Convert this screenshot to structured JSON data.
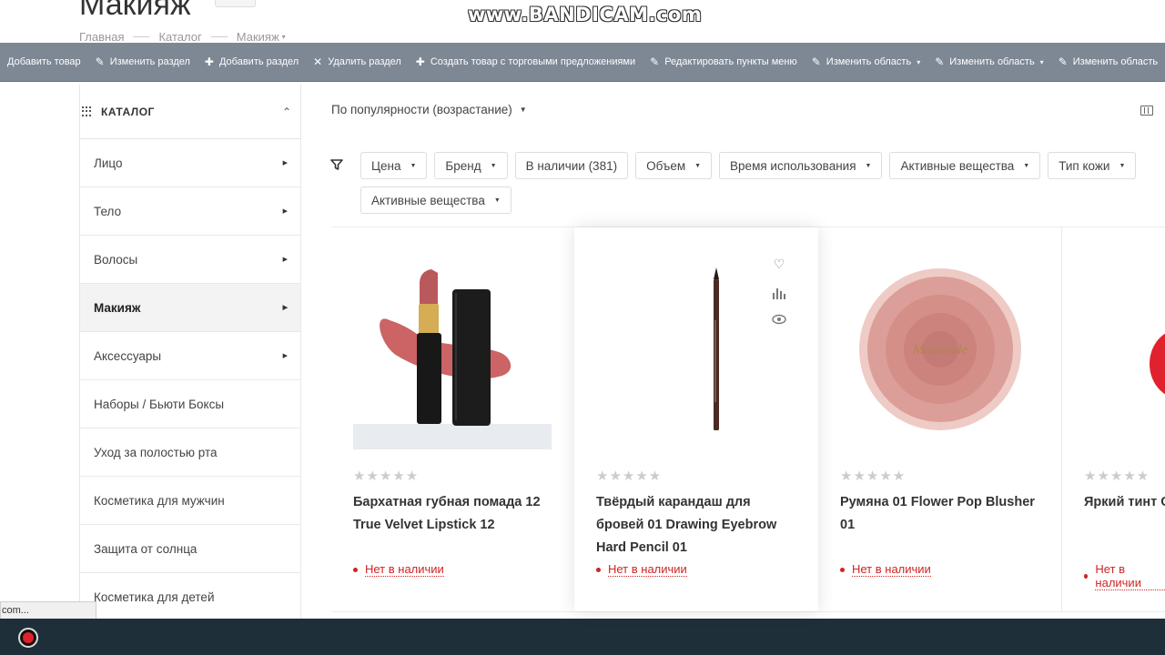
{
  "page": {
    "title": "Макияж",
    "breadcrumb": [
      "Главная",
      "Каталог",
      "Макияж"
    ]
  },
  "watermark": "www.BANDICAM.com",
  "admin_toolbar": [
    {
      "icon": "plus-icon",
      "label": "Добавить товар"
    },
    {
      "icon": "pencil-icon",
      "label": "Изменить раздел"
    },
    {
      "icon": "plus-icon",
      "label": "Добавить раздел"
    },
    {
      "icon": "close-icon",
      "label": "Удалить раздел"
    },
    {
      "icon": "plus-icon",
      "label": "Создать товар с торговыми предложениями"
    },
    {
      "icon": "pencil-icon",
      "label": "Редактировать пункты меню"
    },
    {
      "icon": "pencil-icon",
      "label": "Изменить область",
      "dropdown": true
    },
    {
      "icon": "pencil-icon",
      "label": "Изменить область",
      "dropdown": true
    },
    {
      "icon": "pencil-icon",
      "label": "Изменить область"
    }
  ],
  "sidebar": {
    "header": "КАТАЛОГ",
    "items": [
      {
        "label": "Лицо",
        "has_children": true
      },
      {
        "label": "Тело",
        "has_children": true
      },
      {
        "label": "Волосы",
        "has_children": true
      },
      {
        "label": "Макияж",
        "has_children": true,
        "active": true
      },
      {
        "label": "Аксессуары",
        "has_children": true
      },
      {
        "label": "Наборы / Бьюти Боксы",
        "has_children": false
      },
      {
        "label": "Уход за полостью рта",
        "has_children": false
      },
      {
        "label": "Косметика для мужчин",
        "has_children": false
      },
      {
        "label": "Защита от солнца",
        "has_children": false
      },
      {
        "label": "Косметика для детей",
        "has_children": false
      }
    ]
  },
  "sort": {
    "label": "По популярности (возрастание)"
  },
  "filters": [
    "Цена",
    "Бренд",
    "В наличии (381)",
    "Объем",
    "Время использования",
    "Активные вещества",
    "Тип кожи",
    "Активные вещества"
  ],
  "products": [
    {
      "name": "Бархатная губная помада 12 True Velvet Lipstick 12",
      "stock": "Нет в наличии",
      "rating": 0
    },
    {
      "name": "Твёрдый карандаш для бровей 01 Drawing Eyebrow Hard Pencil 01",
      "stock": "Нет в наличии",
      "rating": 0
    },
    {
      "name": "Румяна 01 Flower Pop Blusher 01",
      "stock": "Нет в наличии",
      "rating": 0,
      "brand_print": "Mamonde"
    },
    {
      "name": "Яркий тинт Colorful Vivid",
      "stock": "Нет в наличии",
      "rating": 0
    }
  ],
  "stars": "★★★★★",
  "status_url": "com...",
  "colors": {
    "admin_bar": "#7e8794",
    "stock_red": "#d02323",
    "taskbar": "#1f2f39"
  }
}
